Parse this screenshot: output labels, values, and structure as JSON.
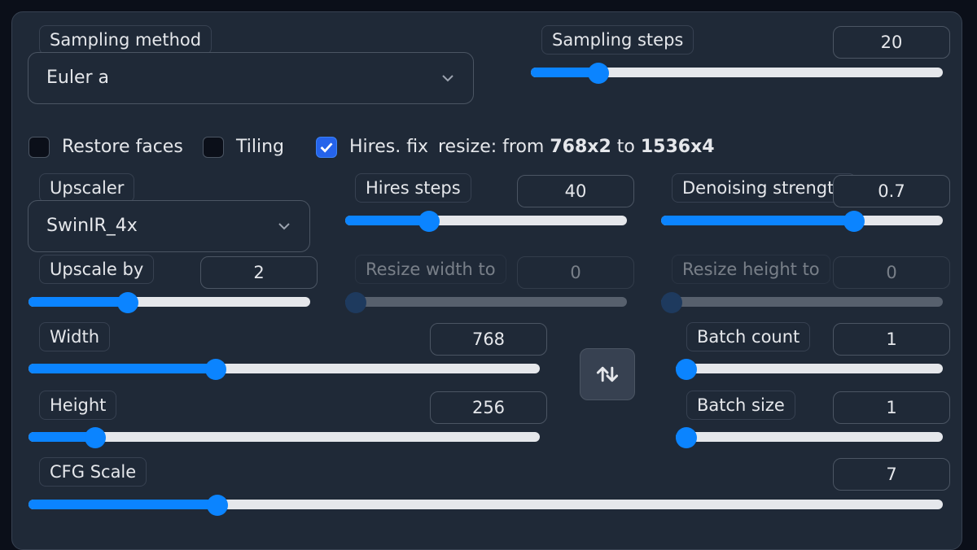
{
  "sampling": {
    "method_label": "Sampling method",
    "method_value": "Euler a",
    "steps_label": "Sampling steps",
    "steps_value": "20",
    "steps_fraction": 0.145
  },
  "options": {
    "restore_faces": {
      "label": "Restore faces",
      "checked": false
    },
    "tiling": {
      "label": "Tiling",
      "checked": false
    },
    "hires_fix": {
      "label": "Hires. fix",
      "checked": true
    },
    "resize_prefix": "resize: from ",
    "resize_from": "768x2",
    "resize_mid": " to ",
    "resize_to": "1536x4"
  },
  "hires": {
    "upscaler_label": "Upscaler",
    "upscaler_value": "SwinIR_4x",
    "steps_label": "Hires steps",
    "steps_value": "40",
    "steps_fraction": 0.28,
    "denoise_label": "Denoising strength",
    "denoise_value": "0.7",
    "denoise_fraction": 0.7,
    "upscale_by_label": "Upscale by",
    "upscale_by_value": "2",
    "upscale_by_fraction": 0.34,
    "resize_width_label": "Resize width to",
    "resize_width_value": "0",
    "resize_width_fraction": 0,
    "resize_height_label": "Resize height to",
    "resize_height_value": "0",
    "resize_height_fraction": 0
  },
  "dimensions": {
    "width_label": "Width",
    "width_value": "768",
    "width_fraction": 0.36,
    "height_label": "Height",
    "height_value": "256",
    "height_fraction": 0.115
  },
  "batch": {
    "count_label": "Batch count",
    "count_value": "1",
    "count_fraction": 0,
    "size_label": "Batch size",
    "size_value": "1",
    "size_fraction": 0
  },
  "cfg": {
    "label": "CFG Scale",
    "value": "7",
    "fraction": 0.2
  },
  "icons": {
    "dropdown": "chevron-down-icon",
    "swap": "swap-vertical-icon",
    "check": "check-icon"
  },
  "colors": {
    "accent": "#0b84ff",
    "panel": "#1f2937",
    "background": "#0b0f19"
  }
}
